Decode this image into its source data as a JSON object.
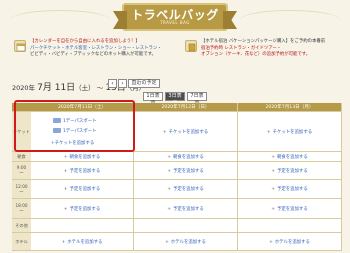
{
  "header": {
    "title": "トラベルバッグ",
    "subtitle": "TRAVEL BAG"
  },
  "info_left": {
    "line1_prefix": "【カレンダーを自在から自由に入れるを追加しよう！】",
    "line2": "パークチケット・ホテル客室・レストラン・ショー・レストラン・",
    "line3": "ビビディ・バビディ・ブティックなどのネット購入が可能です。"
  },
  "info_right": {
    "line1": "【ホテル宿泊 バケーションパッケージ購入】をご予約の本番前",
    "line2": "宿泊予約時 レストラン・ガイドツアー・",
    "line3": "オプション（ケーキ、花など）の追加予約が可能です。"
  },
  "datebar": {
    "year": "2020年",
    "month_day": "7月 11日",
    "weekday": "（土）",
    "sep": "～",
    "end_day": "13日",
    "end_weekday": "（月）",
    "prev_icon": "chevron-left-icon",
    "next_icon": "chevron-right-icon",
    "latest_label": "直近の予定"
  },
  "views": [
    "1日表示",
    "3日表示",
    "7日表示"
  ],
  "columns": [
    "2020年7月11日（土）",
    "2020年7月12日（日）",
    "2020年7月13日（月）"
  ],
  "rows": [
    {
      "label": "チケット",
      "cells": [
        "",
        "チケットを追加する",
        "チケットを追加する"
      ]
    },
    {
      "label": "朝食",
      "cells": [
        "朝食を追加する",
        "朝食を追加する",
        "朝食を追加する"
      ]
    },
    {
      "label": "9:00\n〜",
      "cells": [
        "予定を追加する",
        "予定を追加する",
        "予定を追加する"
      ]
    },
    {
      "label": "12:00\n〜",
      "cells": [
        "予定を追加する",
        "予定を追加する",
        "予定を追加する"
      ]
    },
    {
      "label": "18:00\n〜",
      "cells": [
        "予定を追加する",
        "予定を追加する",
        "予定を追加する"
      ]
    },
    {
      "label": "その他",
      "cells": [
        "",
        "",
        ""
      ]
    },
    {
      "label": "ホテル",
      "cells": [
        "ホテルを追加する",
        "ホテルを追加する",
        "ホテルを追加する"
      ]
    }
  ],
  "tickets": [
    "1デーパスポート",
    "1デーパスポート"
  ],
  "first_ticket_add": "チケットを追加する",
  "colors": {
    "gold": "#b59a4a",
    "link": "#2e5fb5",
    "highlight": "#d11a1a"
  }
}
